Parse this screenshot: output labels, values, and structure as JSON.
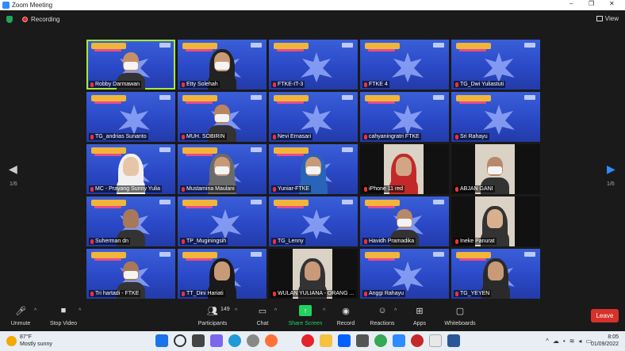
{
  "window": {
    "title": "Zoom Meeting",
    "controls": [
      "–",
      "❐",
      "✕"
    ]
  },
  "topbar": {
    "recording_label": "Recording",
    "view_label": "View"
  },
  "pager": {
    "left": "1/6",
    "right": "1/6"
  },
  "participants": [
    {
      "name": "Robby Darmawan",
      "type": "person",
      "active": true,
      "skin": "#c58f6a",
      "mask": true
    },
    {
      "name": "Etty Solehah",
      "type": "person",
      "skin": "#c99a76",
      "hijab": "#222",
      "mask": true
    },
    {
      "name": "FTKE-IT-3",
      "type": "banner"
    },
    {
      "name": "FTKE 4",
      "type": "banner"
    },
    {
      "name": "TG_Dwi Yuliastuti",
      "type": "banner"
    },
    {
      "name": "TG_andrias Sunanto",
      "type": "banner"
    },
    {
      "name": "MUH. SOBIRIN",
      "type": "person",
      "skin": "#b98562",
      "mask": true
    },
    {
      "name": "Nevi Ernasari",
      "type": "banner"
    },
    {
      "name": "cahyaningratri FTKE",
      "type": "banner"
    },
    {
      "name": "Sri Rahayu",
      "type": "banner"
    },
    {
      "name": "MC - Prayang Sunny Yulia",
      "type": "person",
      "skin": "#e7c6a8",
      "hijab": "#f1f1f1"
    },
    {
      "name": "Mustamina Maulani",
      "type": "person",
      "skin": "#c89a78",
      "hijab": "#6b6b6b",
      "mask": true
    },
    {
      "name": "Yuniar-FTKE",
      "type": "person",
      "skin": "#c89a78",
      "hijab": "#2a64b8",
      "mask": true
    },
    {
      "name": "iPhone 11 red",
      "type": "photo",
      "skin": "#d2a685",
      "hijab": "#c22a2a"
    },
    {
      "name": "ABJAN GANI",
      "type": "photo",
      "skin": "#b8886a",
      "mask": true
    },
    {
      "name": "Suherman dn",
      "type": "person",
      "skin": "#a8785a"
    },
    {
      "name": "TP_Muginingsih",
      "type": "banner"
    },
    {
      "name": "TG_Lenny",
      "type": "banner"
    },
    {
      "name": "Havidh Pramadika",
      "type": "person",
      "skin": "#b8886a",
      "mask": true
    },
    {
      "name": "Ineke Panurat",
      "type": "photo",
      "skin": "#d8b090",
      "hijab": "#333"
    },
    {
      "name": "Tri hartadi - FTKE",
      "type": "person",
      "skin": "#a8785a",
      "mask": true
    },
    {
      "name": "TT_Dini Hariati",
      "type": "person",
      "skin": "#c89a78",
      "hijab": "#1a1a1a"
    },
    {
      "name": "WULAN YULIANA - ORANG ...",
      "type": "photo",
      "skin": "#c89a78",
      "hijab": "#333"
    },
    {
      "name": "Anggi Rahayu",
      "type": "banner"
    },
    {
      "name": "TG_YEYEN",
      "type": "person",
      "skin": "#c89a78",
      "hijab": "#2a2a2a"
    }
  ],
  "toolbar": {
    "unmute": "Unmute",
    "stop_video": "Stop Video",
    "participants": "Participants",
    "participants_count": "149",
    "chat": "Chat",
    "share_screen": "Share Screen",
    "record": "Record",
    "reactions": "Reactions",
    "apps": "Apps",
    "whiteboards": "Whiteboards",
    "leave": "Leave"
  },
  "taskbar": {
    "temperature": "87°F",
    "weather": "Mostly sunny",
    "time": "8:05",
    "date": "01/09/2022"
  },
  "colors": {
    "accent": "#2d8cff",
    "active_speaker": "#a6e93a",
    "leave": "#d8312a",
    "share": "#23d160"
  }
}
